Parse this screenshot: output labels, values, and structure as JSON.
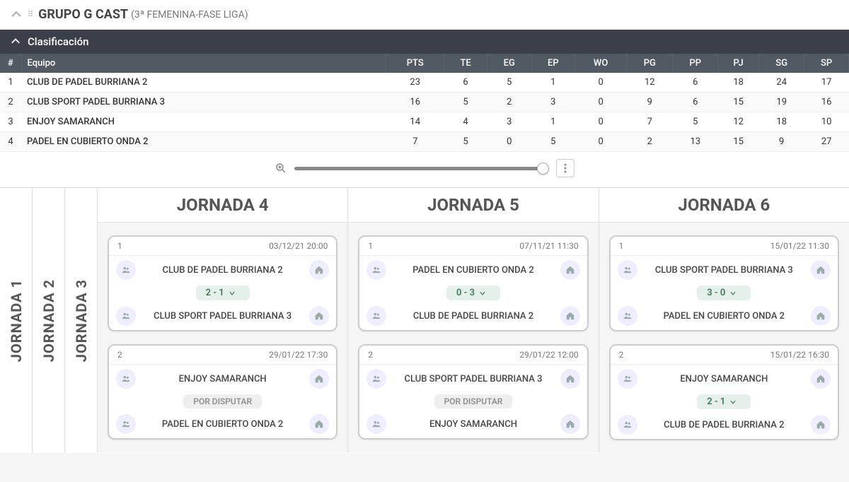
{
  "group": {
    "title_main": "GRUPO G CAST",
    "title_sub": "(3ª FEMENINA-FASE LIGA)"
  },
  "classification_label": "Clasificación",
  "standings": {
    "headers": [
      "#",
      "Equipo",
      "PTS",
      "TE",
      "EG",
      "EP",
      "WO",
      "PG",
      "PP",
      "PJ",
      "SG",
      "SP"
    ],
    "rows": [
      {
        "pos": "1",
        "team": "CLUB DE PADEL BURRIANA 2",
        "pts": "23",
        "te": "6",
        "eg": "5",
        "ep": "1",
        "wo": "0",
        "pg": "12",
        "pp": "6",
        "pj": "18",
        "sg": "24",
        "sp": "17"
      },
      {
        "pos": "2",
        "team": "CLUB SPORT PADEL BURRIANA 3",
        "pts": "16",
        "te": "5",
        "eg": "2",
        "ep": "3",
        "wo": "0",
        "pg": "9",
        "pp": "6",
        "pj": "15",
        "sg": "19",
        "sp": "16"
      },
      {
        "pos": "3",
        "team": "ENJOY SAMARANCH",
        "pts": "14",
        "te": "4",
        "eg": "3",
        "ep": "1",
        "wo": "0",
        "pg": "7",
        "pp": "5",
        "pj": "12",
        "sg": "18",
        "sp": "10"
      },
      {
        "pos": "4",
        "team": "PADEL EN CUBIERTO ONDA 2",
        "pts": "7",
        "te": "5",
        "eg": "0",
        "ep": "5",
        "wo": "0",
        "pg": "2",
        "pp": "13",
        "pj": "15",
        "sg": "9",
        "sp": "27"
      }
    ]
  },
  "vtabs": [
    "JORNADA 1",
    "JORNADA 2",
    "JORNADA 3"
  ],
  "columns": [
    {
      "title": "JORNADA 4",
      "matches": [
        {
          "num": "1",
          "date": "03/12/21 20:00",
          "teamA": "CLUB DE PADEL BURRIANA 2",
          "score": "2 - 1",
          "teamB": "CLUB SPORT PADEL BURRIANA 3",
          "pending": false
        },
        {
          "num": "2",
          "date": "29/01/22 17:30",
          "teamA": "ENJOY SAMARANCH",
          "score": "",
          "teamB": "PADEL EN CUBIERTO ONDA 2",
          "pending": true
        }
      ]
    },
    {
      "title": "JORNADA 5",
      "matches": [
        {
          "num": "1",
          "date": "07/11/21 11:30",
          "teamA": "PADEL EN CUBIERTO ONDA 2",
          "score": "0 - 3",
          "teamB": "CLUB DE PADEL BURRIANA 2",
          "pending": false
        },
        {
          "num": "2",
          "date": "29/01/22 12:00",
          "teamA": "CLUB SPORT PADEL BURRIANA 3",
          "score": "",
          "teamB": "ENJOY SAMARANCH",
          "pending": true
        }
      ]
    },
    {
      "title": "JORNADA 6",
      "matches": [
        {
          "num": "1",
          "date": "15/01/22 11:30",
          "teamA": "CLUB SPORT PADEL BURRIANA 3",
          "score": "3 - 0",
          "teamB": "PADEL EN CUBIERTO ONDA 2",
          "pending": false
        },
        {
          "num": "2",
          "date": "15/01/22 16:30",
          "teamA": "ENJOY SAMARANCH",
          "score": "2 - 1",
          "teamB": "CLUB DE PADEL BURRIANA 2",
          "pending": false
        }
      ]
    }
  ],
  "pending_label": "POR DISPUTAR"
}
